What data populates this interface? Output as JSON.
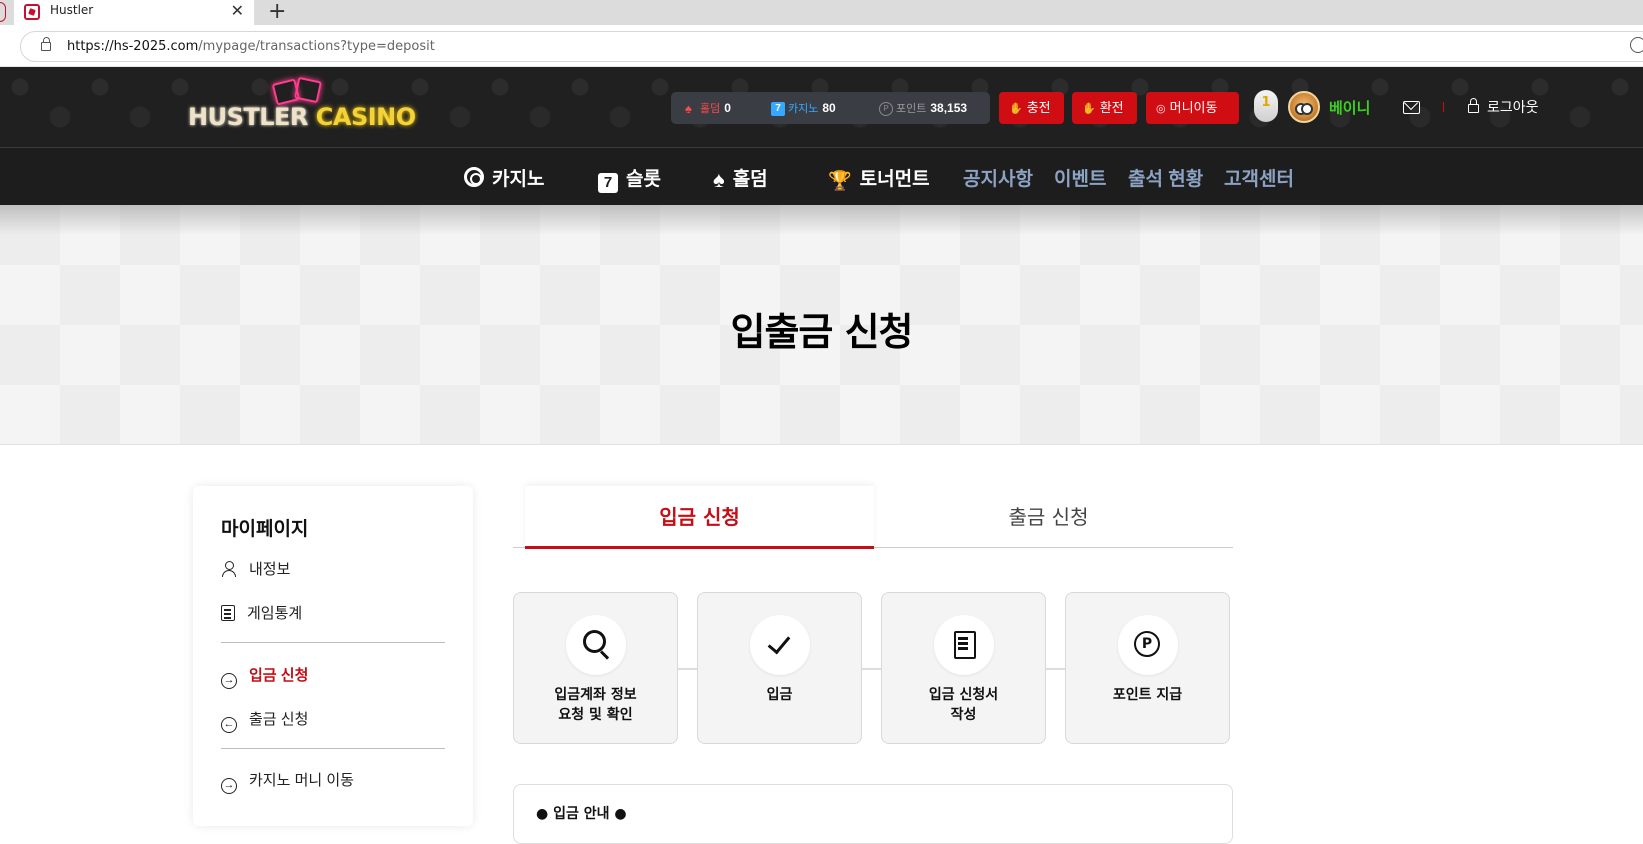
{
  "browser": {
    "tab_title": "Hustler",
    "url_host": "https://hs-2025.com",
    "url_path": "/mypage/transactions?type=deposit"
  },
  "header": {
    "logo_word1": "HUSTLER",
    "logo_word2": "CASINO",
    "balances": {
      "holdem_label": "홀덤",
      "holdem_value": "0",
      "casino_label": "카지노",
      "casino_value": "80",
      "point_label": "포인트",
      "point_value": "38,153"
    },
    "buttons": {
      "charge": "충전",
      "exchange": "환전",
      "money_transfer": "머니이동"
    },
    "level": "1",
    "username": "베이니",
    "logout": "로그아웃",
    "colors": {
      "brand_red": "#d10d14",
      "username_green": "#3bd21f"
    }
  },
  "nav": {
    "casino": "카지노",
    "slot": "슬롯",
    "holdem": "홀덤",
    "tournament": "토너먼트",
    "notice": "공지사항",
    "event": "이벤트",
    "attendance": "출석 현황",
    "support": "고객센터"
  },
  "hero": {
    "title": "입출금 신청"
  },
  "sidebar": {
    "title": "마이페이지",
    "items": [
      {
        "label": "내정보",
        "icon": "person-icon"
      },
      {
        "label": "게임통계",
        "icon": "document-icon"
      },
      {
        "label": "입금 신청",
        "icon": "arrow-right-circle-icon",
        "active": true
      },
      {
        "label": "출금 신청",
        "icon": "arrow-left-circle-icon"
      },
      {
        "label": "카지노 머니 이동",
        "icon": "arrow-right-circle-icon"
      }
    ]
  },
  "tabs": {
    "deposit": "입금 신청",
    "withdraw": "출금 신청"
  },
  "steps": [
    {
      "label": "입금계좌 정보\n요청 및 확인",
      "icon": "search-icon"
    },
    {
      "label": "입금",
      "icon": "check-icon"
    },
    {
      "label": "입금 신청서\n작성",
      "icon": "form-icon"
    },
    {
      "label": "포인트 지급",
      "icon": "point-icon"
    }
  ],
  "info": {
    "title": "● 입금 안내 ●"
  }
}
